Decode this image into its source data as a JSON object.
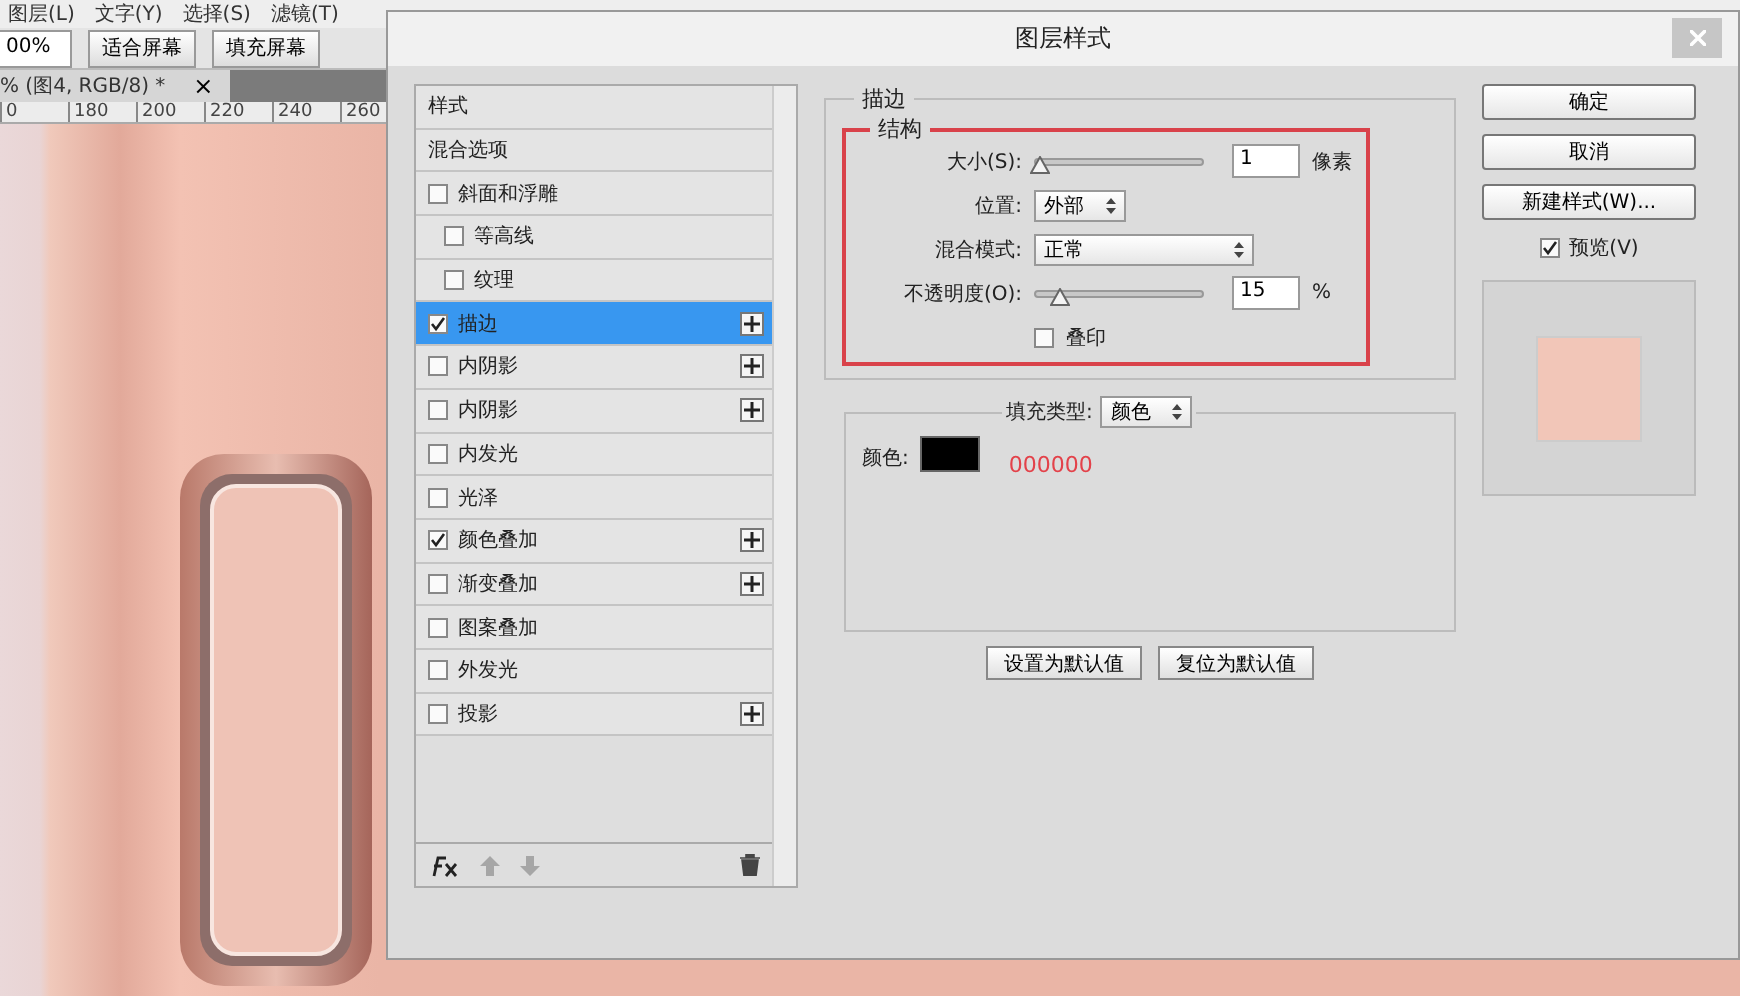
{
  "menu": [
    "图层(L)",
    "文字(Y)",
    "选择(S)",
    "滤镜(T)"
  ],
  "toolbar": {
    "zoom_value": "00%",
    "buttons": [
      "适合屏幕",
      "填充屏幕"
    ]
  },
  "document_tab": {
    "title": "% (图4, RGB/8) *",
    "close": "×"
  },
  "ruler": [
    "0",
    "180",
    "200",
    "220",
    "240",
    "260"
  ],
  "dialog": {
    "title": "图层样式",
    "styles": [
      {
        "kind": "header",
        "label": "样式",
        "selected": false
      },
      {
        "kind": "option",
        "label": "混合选项",
        "selected": false
      },
      {
        "kind": "effect",
        "label": "斜面和浮雕",
        "checked": false,
        "selected": false,
        "addable": false,
        "children": [
          {
            "kind": "effect",
            "label": "等高线",
            "checked": false,
            "selected": false,
            "addable": false
          },
          {
            "kind": "effect",
            "label": "纹理",
            "checked": false,
            "selected": false,
            "addable": false
          }
        ]
      },
      {
        "kind": "effect",
        "label": "描边",
        "checked": true,
        "selected": true,
        "addable": true
      },
      {
        "kind": "effect",
        "label": "内阴影",
        "checked": false,
        "selected": false,
        "addable": true
      },
      {
        "kind": "effect",
        "label": "内阴影",
        "checked": false,
        "selected": false,
        "addable": true
      },
      {
        "kind": "effect",
        "label": "内发光",
        "checked": false,
        "selected": false,
        "addable": false
      },
      {
        "kind": "effect",
        "label": "光泽",
        "checked": false,
        "selected": false,
        "addable": false
      },
      {
        "kind": "effect",
        "label": "颜色叠加",
        "checked": true,
        "selected": false,
        "addable": true
      },
      {
        "kind": "effect",
        "label": "渐变叠加",
        "checked": false,
        "selected": false,
        "addable": true
      },
      {
        "kind": "effect",
        "label": "图案叠加",
        "checked": false,
        "selected": false,
        "addable": false
      },
      {
        "kind": "effect",
        "label": "外发光",
        "checked": false,
        "selected": false,
        "addable": false
      },
      {
        "kind": "effect",
        "label": "投影",
        "checked": false,
        "selected": false,
        "addable": true
      }
    ],
    "stroke": {
      "title": "描边",
      "structure": {
        "title": "结构",
        "size": {
          "label": "大小(S):",
          "level": 0.02,
          "value": "1",
          "unit": "像素"
        },
        "position": {
          "label": "位置:",
          "value": "外部"
        },
        "blend_mode": {
          "label": "混合模式:",
          "value": "正常"
        },
        "opacity": {
          "label": "不透明度(O):",
          "level": 0.15,
          "value": "15",
          "unit": "%"
        },
        "overprint": {
          "label": "叠印",
          "checked": false
        }
      },
      "fill_type": {
        "label": "填充类型:",
        "value": "颜色"
      },
      "color": {
        "label": "颜色:",
        "color": "#000000",
        "hex": "000000"
      },
      "buttons": [
        "设置为默认值",
        "复位为默认值"
      ]
    },
    "buttons": [
      "确定",
      "取消",
      "新建样式(W)..."
    ],
    "preview": {
      "label": "预览(V)",
      "checked": true
    }
  }
}
